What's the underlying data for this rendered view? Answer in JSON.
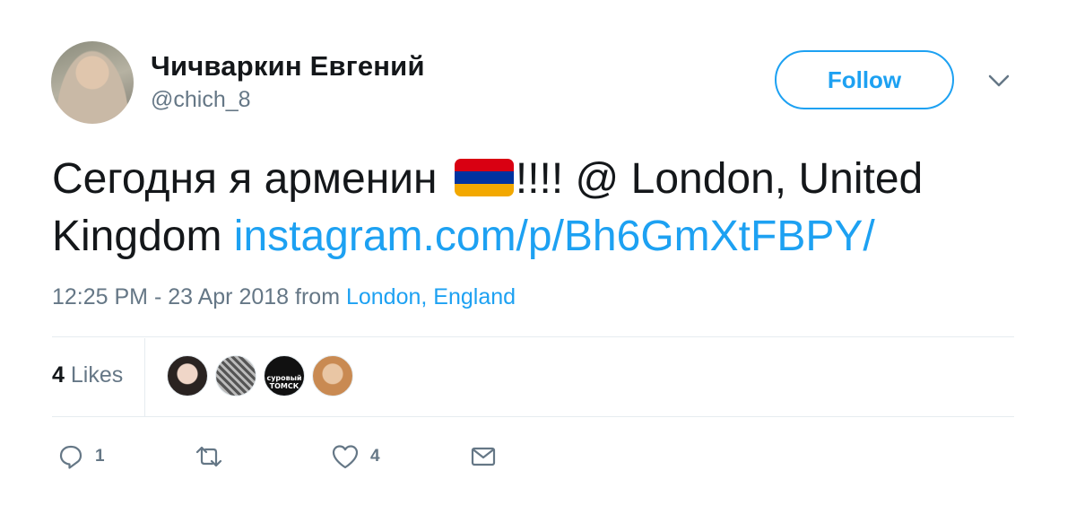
{
  "header": {
    "name": "Чичваркин Евгений",
    "handle": "@chich_8",
    "follow_label": "Follow"
  },
  "tweet": {
    "text_before_flag": "Сегодня я арменин ",
    "text_after_flag": "!!!! @ London, United Kingdom ",
    "link": "instagram.com/p/Bh6GmXtFBPY/",
    "flag_icon": "armenia-flag-emoji"
  },
  "meta": {
    "timestamp": "12:25 PM - 23 Apr 2018",
    "from_word": "from",
    "location": "London, England"
  },
  "likes": {
    "count": "4",
    "label": "Likes",
    "liker_3_text": "суровый ТОМСК"
  },
  "actions": {
    "reply_count": "1",
    "retweet_count": "",
    "like_count": "4"
  },
  "colors": {
    "accent": "#1da1f2",
    "secondary_text": "#657786",
    "divider": "#e6ecf0"
  }
}
